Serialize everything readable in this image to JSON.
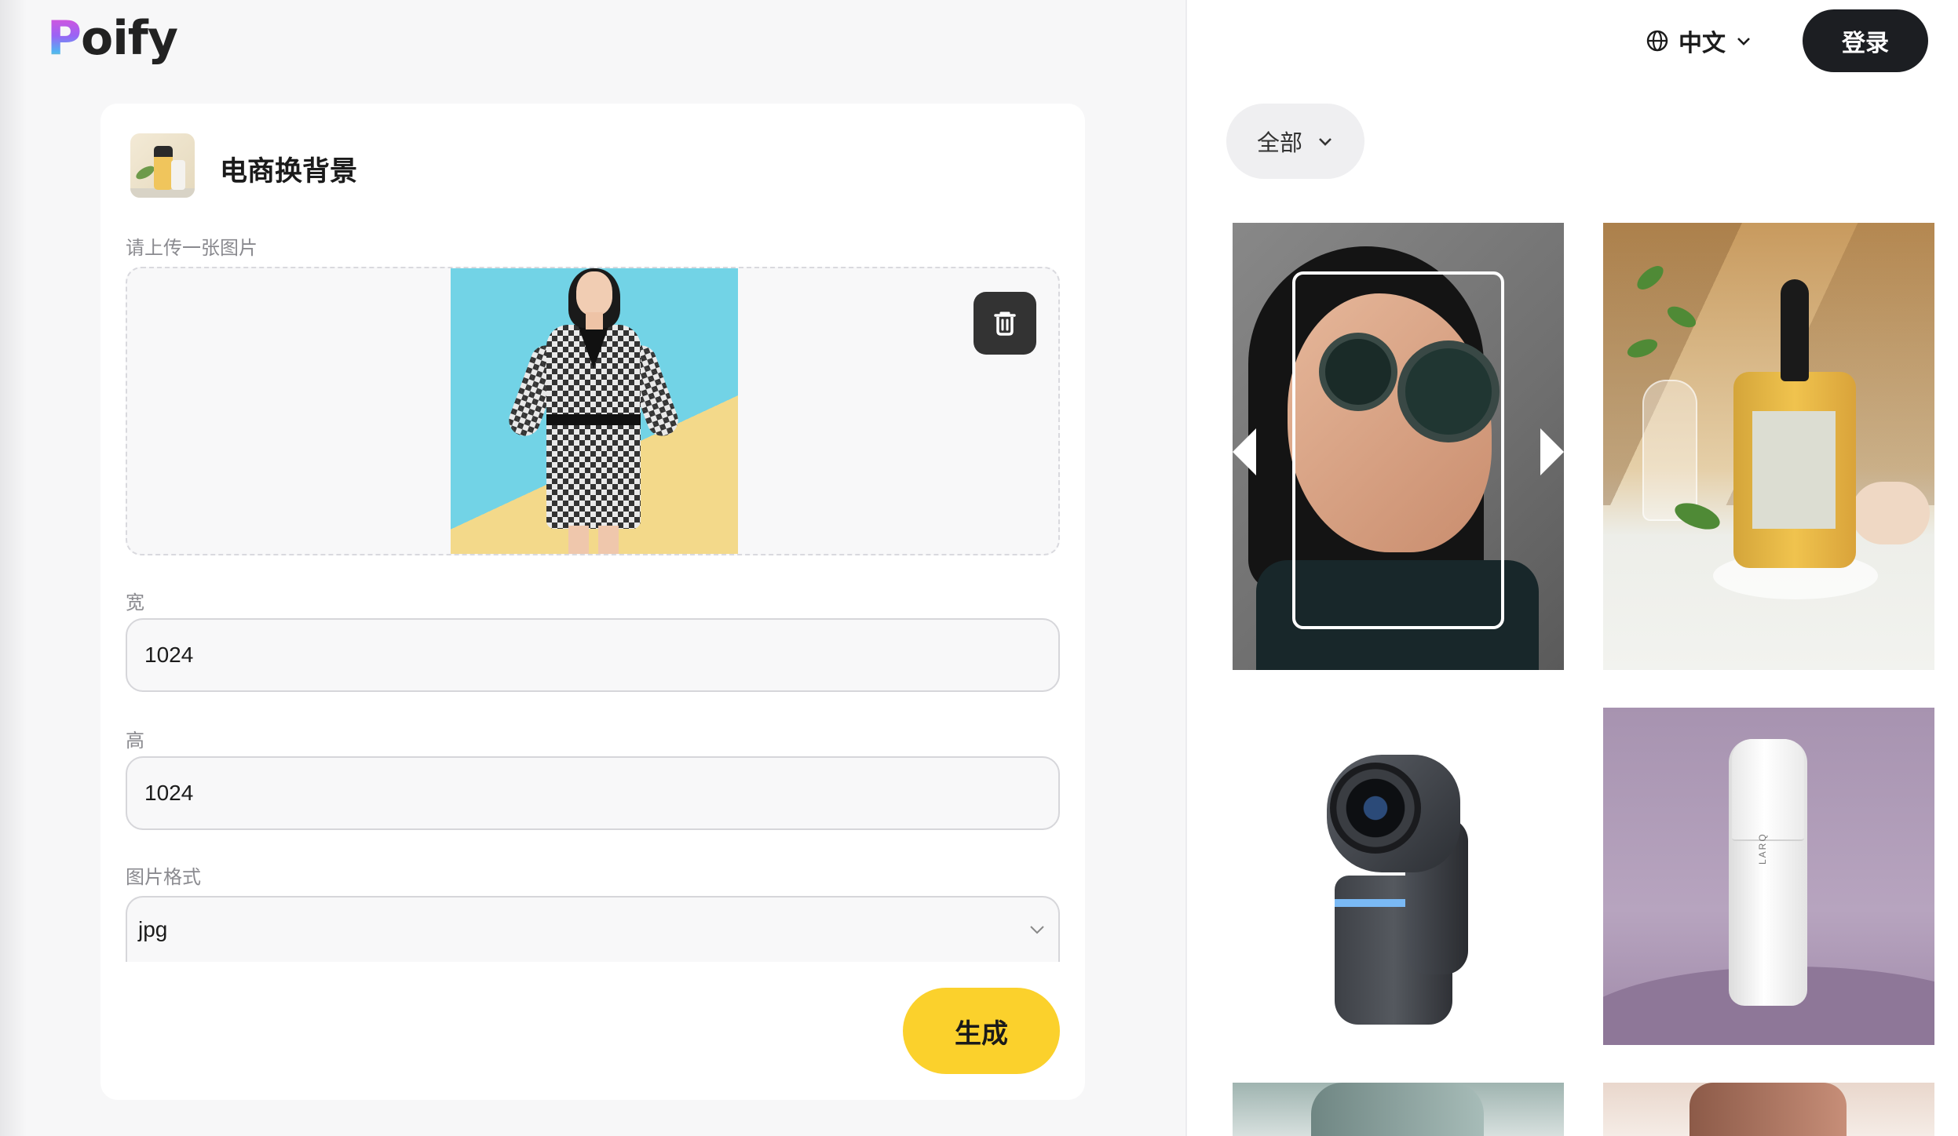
{
  "brand": {
    "logo_first": "P",
    "logo_rest": "oify"
  },
  "header": {
    "language": "中文",
    "login_label": "登录"
  },
  "tool": {
    "title": "电商换背景"
  },
  "form": {
    "upload_label": "请上传一张图片",
    "width_label": "宽",
    "width_value": "1024",
    "height_label": "高",
    "height_value": "1024",
    "format_label": "图片格式",
    "format_value": "jpg",
    "generate_label": "生成"
  },
  "gallery": {
    "filter_label": "全部",
    "tiles": [
      {
        "subject": "woman with futuristic sunglasses"
      },
      {
        "subject": "serum dropper bottle with plant"
      },
      {
        "subject": "gimbal webcam"
      },
      {
        "subject": "white bottle on purple background",
        "brand_text": "LARQ"
      },
      {
        "subject": "partial image"
      },
      {
        "subject": "partial image"
      }
    ]
  },
  "colors": {
    "accent_yellow": "#fbd12c",
    "login_dark": "#1c1e22",
    "delete_dark": "#333333"
  },
  "icons": [
    "globe-icon",
    "chevron-down-icon",
    "trash-icon"
  ]
}
